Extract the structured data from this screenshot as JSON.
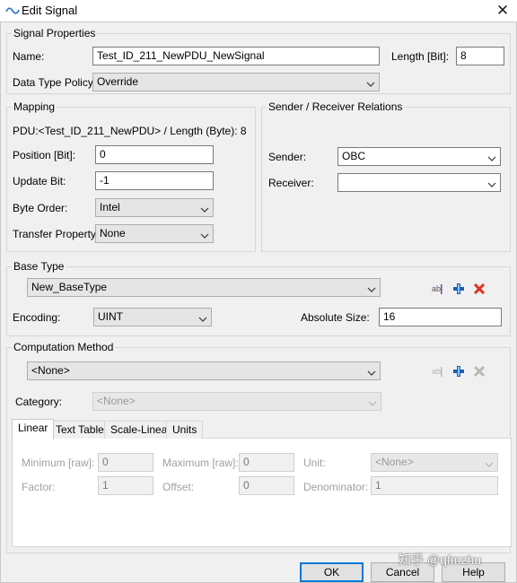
{
  "window": {
    "title": "Edit Signal",
    "close_glyph": "✕",
    "icon": "signal-wave-icon"
  },
  "signal_properties": {
    "legend": "Signal Properties",
    "name_label": "Name:",
    "name_value": "Test_ID_211_NewPDU_NewSignal",
    "length_label": "Length [Bit]:",
    "length_value": "8",
    "policy_label": "Data Type Policy:",
    "policy_value": "Override"
  },
  "mapping": {
    "legend": "Mapping",
    "pdu_text": "PDU:<Test_ID_211_NewPDU> / Length (Byte): 8",
    "position_label": "Position [Bit]:",
    "position_value": "0",
    "update_label": "Update Bit:",
    "update_value": "-1",
    "byte_order_label": "Byte Order:",
    "byte_order_value": "Intel",
    "transfer_label": "Transfer Property:",
    "transfer_value": "None"
  },
  "sender_receiver": {
    "legend": "Sender / Receiver Relations",
    "sender_label": "Sender:",
    "sender_value": "OBC",
    "receiver_label": "Receiver:",
    "receiver_value": ""
  },
  "base_type": {
    "legend": "Base Type",
    "value": "New_BaseType",
    "encoding_label": "Encoding:",
    "encoding_value": "UINT",
    "abs_size_label": "Absolute Size:",
    "abs_size_value": "16",
    "icons": [
      "rename-icon",
      "add-icon",
      "delete-icon"
    ]
  },
  "computation": {
    "legend": "Computation Method",
    "value": "<None>",
    "category_label": "Category:",
    "category_value": "<None>",
    "tabs": [
      "Linear",
      "Text Table",
      "Scale-Linear",
      "Units"
    ],
    "active_tab": "Linear",
    "linear": {
      "min_label": "Minimum [raw]:",
      "min_value": "0",
      "max_label": "Maximum [raw]:",
      "max_value": "0",
      "unit_label": "Unit:",
      "unit_value": "<None>",
      "factor_label": "Factor:",
      "factor_value": "1",
      "offset_label": "Offset:",
      "offset_value": "0",
      "denominator_label": "Denominator:",
      "denominator_value": "1"
    }
  },
  "buttons": {
    "ok": "OK",
    "cancel": "Cancel",
    "help": "Help"
  },
  "watermark": "知乎 @qfmzhu",
  "colors": {
    "dialog_bg": "#f0f0f0",
    "default_button_border": "#0078d7",
    "add_icon": "#1a5fb4",
    "delete_icon": "#e0301e"
  }
}
